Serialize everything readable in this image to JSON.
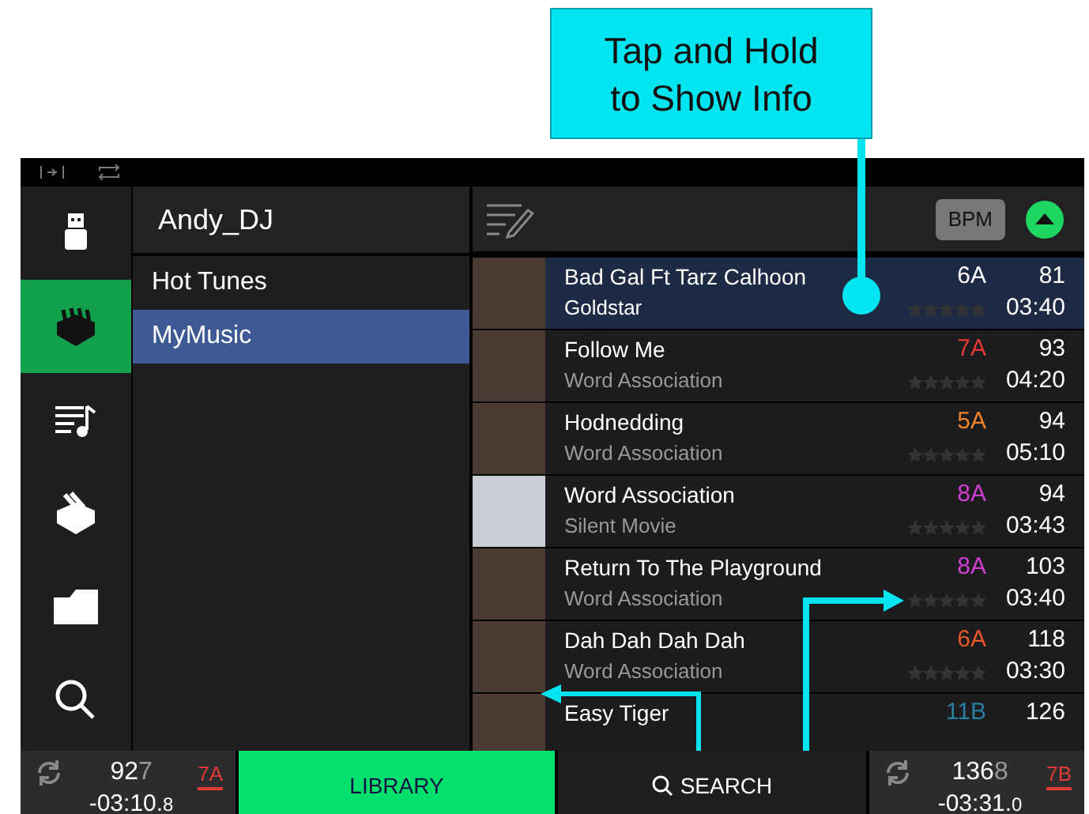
{
  "callout": {
    "text": "Tap and Hold to Show Info"
  },
  "sidebar": {
    "items": [
      {
        "kind": "usb",
        "selected": false
      },
      {
        "kind": "crates",
        "selected": true
      },
      {
        "kind": "playlists",
        "selected": false
      },
      {
        "kind": "prepare",
        "selected": false
      },
      {
        "kind": "files",
        "selected": false
      },
      {
        "kind": "search",
        "selected": false
      }
    ]
  },
  "crates_panel": {
    "title": "Andy_DJ",
    "items": [
      {
        "label": "Hot Tunes",
        "selected": false
      },
      {
        "label": "MyMusic",
        "selected": true
      }
    ]
  },
  "tracks_header": {
    "sort_label": "BPM"
  },
  "tracks": [
    {
      "title": "Bad Gal Ft Tarz Calhoon",
      "artist": "Goldstar",
      "key": "6A",
      "color": "#ffffff",
      "bpm": "81",
      "time": "03:40",
      "stars": 0,
      "selected": true
    },
    {
      "title": "Follow Me",
      "artist": "Word Association",
      "key": "7A",
      "color": "#e53935",
      "bpm": "93",
      "time": "04:20",
      "stars": 0,
      "selected": false
    },
    {
      "title": "Hodnedding",
      "artist": "Word Association",
      "key": "5A",
      "color": "#f0802a",
      "bpm": "94",
      "time": "05:10",
      "stars": 0,
      "selected": false
    },
    {
      "title": "Word Association",
      "artist": "Silent Movie",
      "key": "8A",
      "color": "#d040d0",
      "bpm": "94",
      "time": "03:43",
      "stars": 0,
      "selected": false
    },
    {
      "title": "Return To The Playground",
      "artist": "Word Association",
      "key": "8A",
      "color": "#d040d0",
      "bpm": "103",
      "time": "03:40",
      "stars": 0,
      "selected": false
    },
    {
      "title": "Dah Dah Dah Dah",
      "artist": "Word Association",
      "key": "6A",
      "color": "#e8562a",
      "bpm": "118",
      "time": "03:30",
      "stars": 0,
      "selected": false
    },
    {
      "title": "Easy Tiger",
      "key": "11B",
      "color": "#2a7fa0",
      "bpm": "126",
      "selected": false
    }
  ],
  "bottom_bar": {
    "left_deck": {
      "bpm": "92",
      "bpm_decimal": "7",
      "key": "7A",
      "time": "-03:10.",
      "time_decimal": "8"
    },
    "library_button": {
      "label": "LIBRARY",
      "selected": true
    },
    "search_button": {
      "label": "SEARCH",
      "selected": false
    },
    "right_deck": {
      "bpm": "136",
      "bpm_decimal": "8",
      "key": "7B",
      "time": "-03:31.",
      "time_decimal": "0"
    }
  }
}
